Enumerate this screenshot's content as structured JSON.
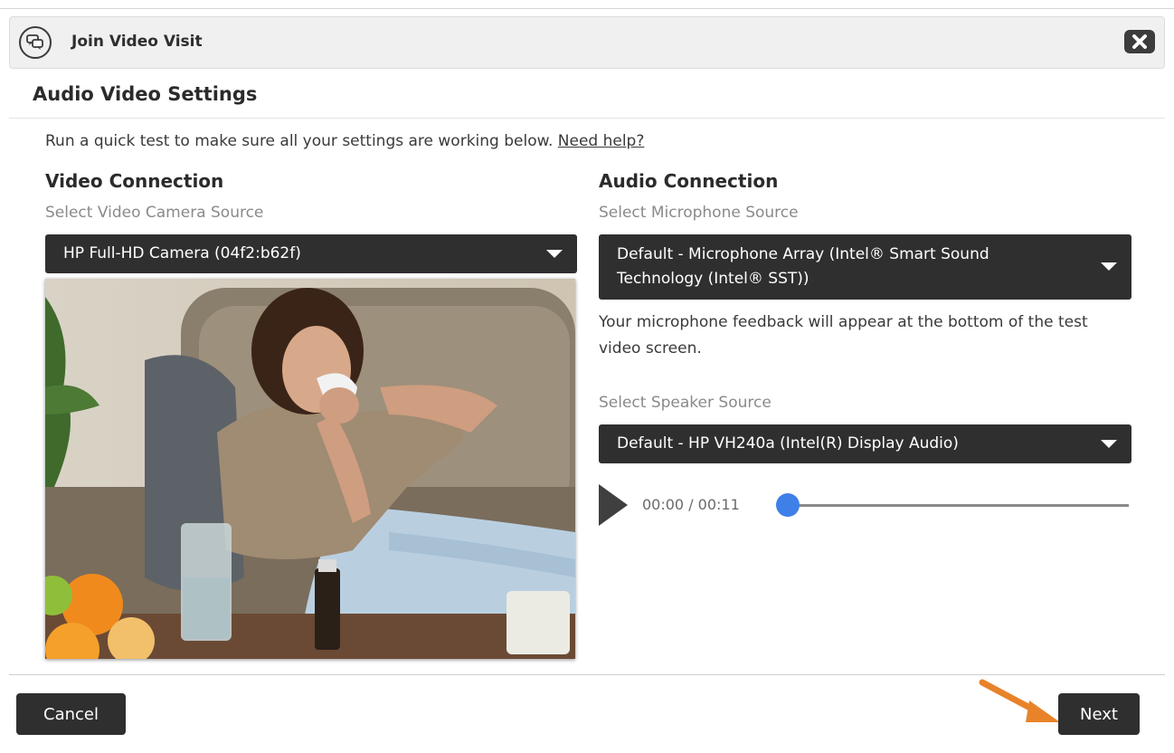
{
  "dialog": {
    "title": "Join Video Visit",
    "heading": "Audio Video Settings",
    "intro_text": "Run a quick test to make sure all your settings are working below.",
    "help_link": "Need help?"
  },
  "video": {
    "section_title": "Video Connection",
    "camera_label": "Select Video Camera Source",
    "camera_value": "HP Full-HD Camera (04f2:b62f)"
  },
  "audio": {
    "section_title": "Audio Connection",
    "mic_label": "Select Microphone Source",
    "mic_value": "Default - Microphone Array (Intel® Smart Sound Technology (Intel® SST))",
    "mic_note": "Your microphone feedback will appear at the bottom of the test video screen.",
    "speaker_label": "Select Speaker Source",
    "speaker_value": "Default - HP VH240a (Intel(R) Display Audio)",
    "player_time": "00:00 / 00:11",
    "progress": 0
  },
  "footer": {
    "cancel_label": "Cancel",
    "next_label": "Next"
  },
  "colors": {
    "accent_slider": "#3f7fe8",
    "button_bg": "#2f2f2f",
    "annotation_arrow": "#e8832a"
  },
  "icons": [
    "chat-bubbles-icon",
    "close-icon",
    "chevron-down-icon",
    "play-icon",
    "arrow-annotation"
  ]
}
